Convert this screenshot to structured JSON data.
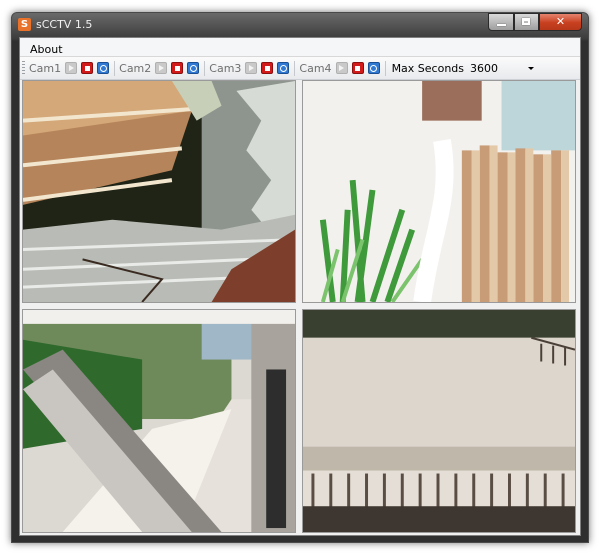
{
  "window": {
    "title": "sCCTV 1.5",
    "app_icon_letter": "S"
  },
  "menu": {
    "items": [
      {
        "label": "About"
      }
    ]
  },
  "toolbar": {
    "cams": [
      {
        "label": "Cam1"
      },
      {
        "label": "Cam2"
      },
      {
        "label": "Cam3"
      },
      {
        "label": "Cam4"
      }
    ],
    "max_seconds_label": "Max Seconds",
    "max_seconds_value": "3600"
  },
  "colors": {
    "stop": "#d31a1a",
    "snapshot": "#2f79d2",
    "close": "#c7401f"
  },
  "icons": {
    "play": "play-icon",
    "stop": "stop-icon",
    "snapshot": "camera-icon"
  },
  "feeds": [
    {
      "name": "cam1-feed"
    },
    {
      "name": "cam2-feed"
    },
    {
      "name": "cam3-feed"
    },
    {
      "name": "cam4-feed"
    }
  ]
}
